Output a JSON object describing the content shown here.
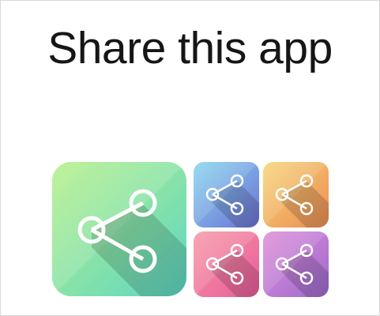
{
  "headline": "Share this app",
  "icons": [
    {
      "name": "share-icon",
      "color": "green",
      "start": "#b7f08a",
      "end": "#5cd6c4"
    },
    {
      "name": "share-icon",
      "color": "blue",
      "start": "#8ad7f0",
      "end": "#6c71d4"
    },
    {
      "name": "share-icon",
      "color": "orange",
      "start": "#f7d57a",
      "end": "#ec8d52"
    },
    {
      "name": "share-icon",
      "color": "pink",
      "start": "#f79aa6",
      "end": "#e95b9a"
    },
    {
      "name": "share-icon",
      "color": "purple",
      "start": "#df8ed8",
      "end": "#9d6bd0"
    }
  ]
}
